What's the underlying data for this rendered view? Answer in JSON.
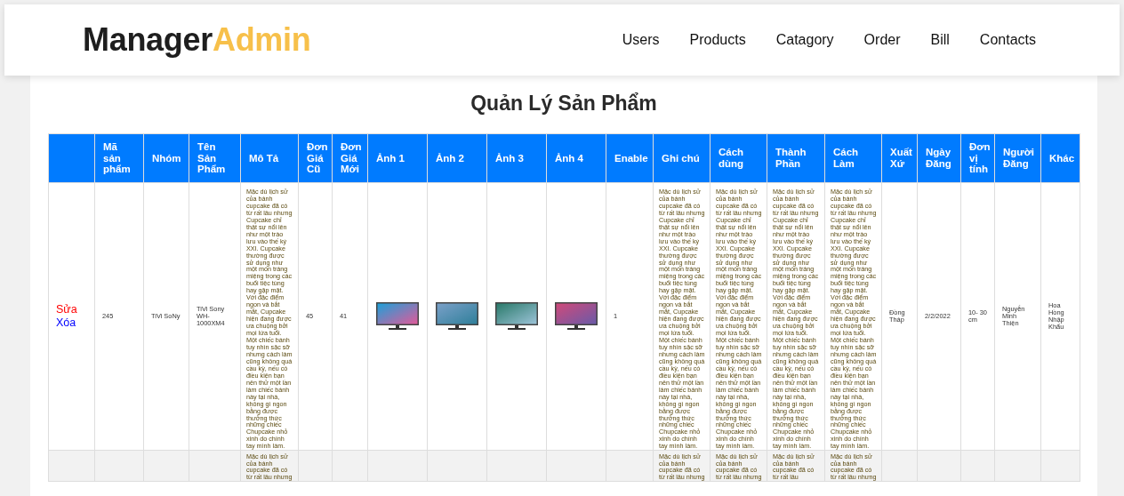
{
  "header": {
    "logo": {
      "first": "Manager",
      "second": "Admin"
    },
    "nav_links": [
      "Users",
      "Products",
      "Catagory",
      "Order",
      "Bill",
      "Contacts"
    ]
  },
  "page_title": "Quản Lý Sản Phẩm",
  "table": {
    "columns": [
      "",
      "Mã sản phẩm",
      "Nhóm",
      "Tên Sản Phẩm",
      "Mô Tả",
      "Đơn Giá Cũ",
      "Đơn Giá Mới",
      "Ảnh 1",
      "Ảnh 2",
      "Ảnh 3",
      "Ảnh 4",
      "Enable",
      "Ghi chú",
      "Cách dùng",
      "Thành Phần",
      "Cách Làm",
      "Xuất Xứ",
      "Ngày Đăng",
      "Đơn vị tính",
      "Người Đăng",
      "Khác"
    ],
    "rows": [
      {
        "cells": [
          {
            "kind": "actions",
            "links": [
              {
                "label": "Sửa",
                "color": "#ff0000"
              },
              {
                "label": "Xóa",
                "color": "#0000ff"
              }
            ]
          },
          {
            "kind": "text",
            "text": "245"
          },
          {
            "kind": "text",
            "text": "TiVi SoNy"
          },
          {
            "kind": "text",
            "text": "TiVi Sony WH-1000XM4"
          },
          {
            "kind": "long",
            "text": "Mặc dù lịch sử của bánh cupcake đã có từ rất lâu nhưng Cupcake chỉ thật sự nổi lên như một trào lưu vào thế kỷ XXI. Cupcake thường được sử dụng như một món tráng miệng trong các buổi tiệc tùng hay gặp mặt. Với đặc điểm ngon và bắt mắt, Cupcake hiện đang được ưa chuộng bởi mọi lứa tuổi. Một chiếc bánh tuy nhìn sặc sỡ nhưng cách làm cũng không quá cầu kỳ, nếu có điều kiện bạn nên thử một lần làm chiếc bánh này tại nhà, không gì ngon bằng được thưởng thức những chiếc Chupcake nhỏ xinh do chính tay mình làm."
          },
          {
            "kind": "text",
            "text": "45"
          },
          {
            "kind": "text",
            "text": "41"
          },
          {
            "kind": "image"
          },
          {
            "kind": "image"
          },
          {
            "kind": "image"
          },
          {
            "kind": "image"
          },
          {
            "kind": "text",
            "text": "1"
          },
          {
            "kind": "long",
            "text": "Mặc dù lịch sử của bánh cupcake đã có từ rất lâu nhưng Cupcake chỉ thật sự nổi lên như một trào lưu vào thế kỷ XXI. Cupcake thường được sử dụng như một món tráng miệng trong các buổi tiệc tùng hay gặp mặt. Với đặc điểm ngon và bắt mắt, Cupcake hiện đang được ưa chuộng bởi mọi lứa tuổi. Một chiếc bánh tuy nhìn sặc sỡ nhưng cách làm cũng không quá cầu kỳ, nếu có điều kiện bạn nên thử một lần làm chiếc bánh này tại nhà, không gì ngon bằng được thưởng thức những chiếc Chupcake nhỏ xinh do chính tay mình làm."
          },
          {
            "kind": "long",
            "text": "Mặc dù lịch sử của bánh cupcake đã có từ rất lâu nhưng Cupcake chỉ thật sự nổi lên như một trào lưu vào thế kỷ XXI. Cupcake thường được sử dụng như một món tráng miệng trong các buổi tiệc tùng hay gặp mặt. Với đặc điểm ngon và bắt mắt, Cupcake hiện đang được ưa chuộng bởi mọi lứa tuổi. Một chiếc bánh tuy nhìn sặc sỡ nhưng cách làm cũng không quá cầu kỳ, nếu có điều kiện bạn nên thử một lần làm chiếc bánh này tại nhà, không gì ngon bằng được thưởng thức những chiếc Chupcake nhỏ xinh do chính tay mình làm."
          },
          {
            "kind": "long",
            "text": "Mặc dù lịch sử của bánh cupcake đã có từ rất lâu nhưng Cupcake chỉ thật sự nổi lên như một trào lưu vào thế kỷ XXI. Cupcake thường được sử dụng như một món tráng miệng trong các buổi tiệc tùng hay gặp mặt. Với đặc điểm ngon và bắt mắt, Cupcake hiện đang được ưa chuộng bởi mọi lứa tuổi. Một chiếc bánh tuy nhìn sặc sỡ nhưng cách làm cũng không quá cầu kỳ, nếu có điều kiện bạn nên thử một lần làm chiếc bánh này tại nhà, không gì ngon bằng được thưởng thức những chiếc Chupcake nhỏ xinh do chính tay mình làm."
          },
          {
            "kind": "long",
            "text": "Mặc dù lịch sử của bánh cupcake đã có từ rất lâu nhưng Cupcake chỉ thật sự nổi lên như một trào lưu vào thế kỷ XXI. Cupcake thường được sử dụng như một món tráng miệng trong các buổi tiệc tùng hay gặp mặt. Với đặc điểm ngon và bắt mắt, Cupcake hiện đang được ưa chuộng bởi mọi lứa tuổi. Một chiếc bánh tuy nhìn sặc sỡ nhưng cách làm cũng không quá cầu kỳ, nếu có điều kiện bạn nên thử một lần làm chiếc bánh này tại nhà, không gì ngon bằng được thưởng thức những chiếc Chupcake nhỏ xinh do chính tay mình làm."
          },
          {
            "kind": "text",
            "text": "Đồng Tháp"
          },
          {
            "kind": "text",
            "text": "2/2/2022"
          },
          {
            "kind": "text",
            "text": "10- 30 cm"
          },
          {
            "kind": "text",
            "text": "Nguyễn Minh Thiện"
          },
          {
            "kind": "text",
            "text": "Hoa Hồng Nhập Khẩu"
          }
        ]
      },
      {
        "cells": [
          {
            "kind": "blank"
          },
          {
            "kind": "blank"
          },
          {
            "kind": "blank"
          },
          {
            "kind": "blank"
          },
          {
            "kind": "long",
            "text": "Mặc dù lịch sử của bánh cupcake đã có từ rất lâu nhưng"
          },
          {
            "kind": "blank"
          },
          {
            "kind": "blank"
          },
          {
            "kind": "blank"
          },
          {
            "kind": "blank"
          },
          {
            "kind": "blank"
          },
          {
            "kind": "blank"
          },
          {
            "kind": "blank"
          },
          {
            "kind": "long",
            "text": "Mặc dù lịch sử của bánh cupcake đã có từ rất lâu nhưng"
          },
          {
            "kind": "long",
            "text": "Mặc dù lịch sử của bánh cupcake đã có từ rất lâu nhưng"
          },
          {
            "kind": "long",
            "text": "Mặc dù lịch sử của bánh cupcake đã có từ rất lâu"
          },
          {
            "kind": "long",
            "text": "Mặc dù lịch sử của bánh cupcake đã có từ rất lâu nhưng"
          },
          {
            "kind": "blank"
          },
          {
            "kind": "blank"
          },
          {
            "kind": "blank"
          },
          {
            "kind": "blank"
          },
          {
            "kind": "blank"
          }
        ]
      }
    ]
  }
}
